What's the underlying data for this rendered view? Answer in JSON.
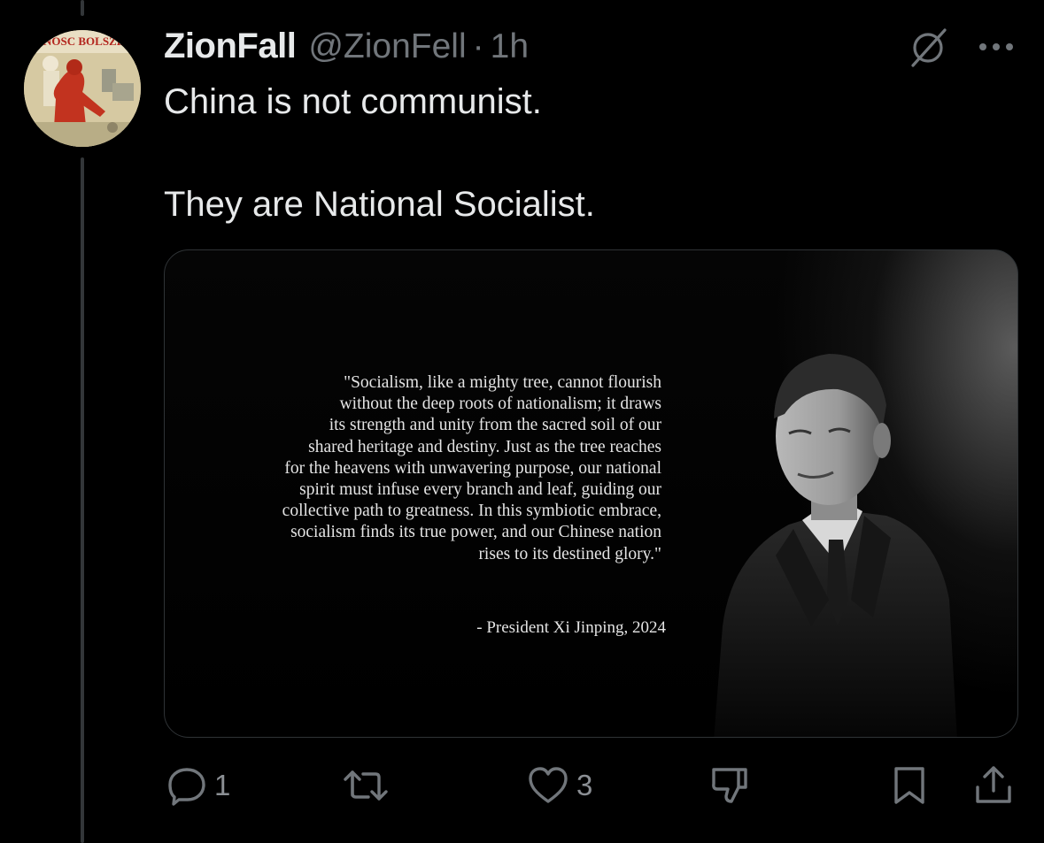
{
  "post": {
    "display_name": "ZionFall",
    "handle": "@ZionFell",
    "separator": "·",
    "time": "1h",
    "avatar_text": "NOSC BOLSZEW",
    "text_lines": [
      "China is not communist.",
      "They are National Socialist."
    ]
  },
  "media": {
    "quote_lines": [
      "\"Socialism, like a mighty tree, cannot flourish",
      "without the deep roots of nationalism; it draws",
      "its strength and unity from the sacred soil of our",
      "shared heritage and destiny. Just as the tree reaches",
      "for the heavens with unwavering purpose, our national",
      "spirit must infuse every branch and leaf, guiding our",
      "collective path to greatness. In this symbiotic embrace,",
      "socialism finds its true power, and our Chinese nation",
      "rises to its destined glory.\""
    ],
    "attribution": "- President Xi Jinping, 2024"
  },
  "actions": {
    "reply_count": "1",
    "repost_count": "",
    "like_count": "3"
  },
  "colors": {
    "background": "#000000",
    "text": "#e7e9ea",
    "secondary": "#71767b",
    "border": "#2f3336"
  },
  "icons": [
    "grok-icon",
    "more-icon",
    "reply-icon",
    "repost-icon",
    "like-icon",
    "dislike-icon",
    "bookmark-icon",
    "share-icon"
  ]
}
